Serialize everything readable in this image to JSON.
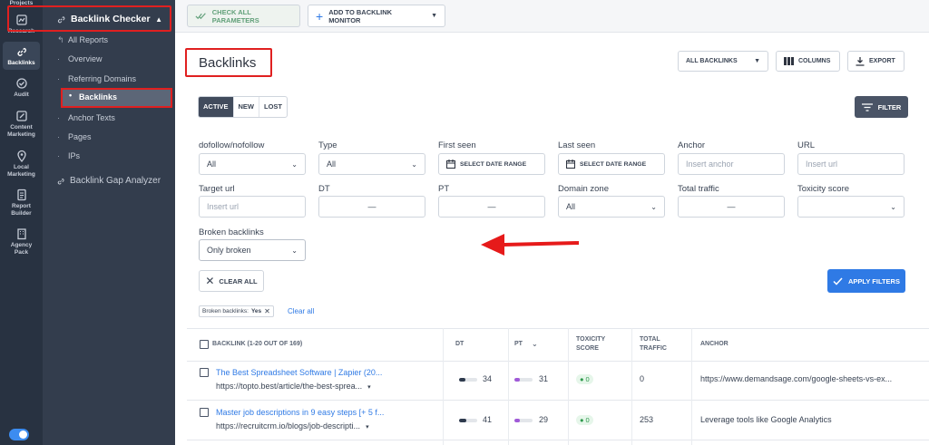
{
  "rail": {
    "items": [
      {
        "label": "Projects",
        "icon": "projects-icon"
      },
      {
        "label": "Research",
        "icon": "research-icon"
      },
      {
        "label": "Backlinks",
        "icon": "link-icon"
      },
      {
        "label": "Audit",
        "icon": "audit-icon"
      },
      {
        "label": "Content Marketing",
        "icon": "content-icon"
      },
      {
        "label": "Local Marketing",
        "icon": "location-pin-icon"
      },
      {
        "label": "Report Builder",
        "icon": "report-icon"
      },
      {
        "label": "Agency Pack",
        "icon": "building-icon"
      }
    ],
    "active": "Backlinks"
  },
  "sidebar": {
    "section_title": "Backlink Checker",
    "items": [
      "All Reports",
      "Overview",
      "Referring Domains",
      "Backlinks",
      "Anchor Texts",
      "Pages",
      "IPs"
    ],
    "active": "Backlinks",
    "gap_analyzer": "Backlink Gap Analyzer"
  },
  "toolbar": {
    "check_all": "CHECK ALL PARAMETERS",
    "add_monitor": "ADD TO BACKLINK MONITOR"
  },
  "page": {
    "title": "Backlinks",
    "all_backlinks": "ALL BACKLINKS",
    "columns": "COLUMNS",
    "export": "EXPORT"
  },
  "tabs": [
    "ACTIVE",
    "NEW",
    "LOST"
  ],
  "filter_button": "FILTER",
  "filters": {
    "dofollow": {
      "label": "dofollow/nofollow",
      "value": "All"
    },
    "type": {
      "label": "Type",
      "value": "All"
    },
    "first_seen": {
      "label": "First seen",
      "value": "SELECT DATE RANGE"
    },
    "last_seen": {
      "label": "Last seen",
      "value": "SELECT DATE RANGE"
    },
    "anchor": {
      "label": "Anchor",
      "placeholder": "Insert anchor"
    },
    "url": {
      "label": "URL",
      "placeholder": "Insert url"
    },
    "target_url": {
      "label": "Target url",
      "placeholder": "Insert url"
    },
    "dt": {
      "label": "DT",
      "sep": "—"
    },
    "pt": {
      "label": "PT",
      "sep": "—"
    },
    "domain_zone": {
      "label": "Domain zone",
      "value": "All"
    },
    "total_traffic": {
      "label": "Total traffic",
      "sep": "—"
    },
    "toxicity": {
      "label": "Toxicity score",
      "value": ""
    },
    "broken": {
      "label": "Broken backlinks",
      "value": "Only broken"
    }
  },
  "clear_all_button": "CLEAR ALL",
  "apply_button": "APPLY FILTERS",
  "active_chip": {
    "label": "Broken backlinks:",
    "value": "Yes"
  },
  "clear_all_link": "Clear all",
  "table": {
    "headers": {
      "backlink": "BACKLINK (1-20 OUT OF 169)",
      "dt": "DT",
      "pt": "PT",
      "toxicity": "TOXICITY SCORE",
      "traffic": "TOTAL TRAFFIC",
      "anchor": "ANCHOR"
    },
    "rows": [
      {
        "title": "The Best Spreadsheet Software | Zapier (20...",
        "url": "https://topto.best/article/the-best-sprea...",
        "dt": "34",
        "dt_fill": 0.34,
        "pt": "31",
        "pt_fill": 0.31,
        "toxicity": "0",
        "traffic": "0",
        "anchor": "https://www.demandsage.com/google-sheets-vs-ex..."
      },
      {
        "title": "Master job descriptions in 9 easy steps [+ 5 f...",
        "url": "https://recruitcrm.io/blogs/job-descripti...",
        "dt": "41",
        "dt_fill": 0.41,
        "pt": "29",
        "pt_fill": 0.29,
        "toxicity": "0",
        "traffic": "253",
        "anchor": "Leverage tools like Google Analytics"
      }
    ]
  },
  "colors": {
    "accent": "#2f7ae5",
    "rail_bg": "#283241",
    "sidebar_bg": "#333d4d",
    "highlight": "#e02020",
    "dt_bar": "#2e3a4d",
    "pt_bar": "#a05ad8"
  }
}
